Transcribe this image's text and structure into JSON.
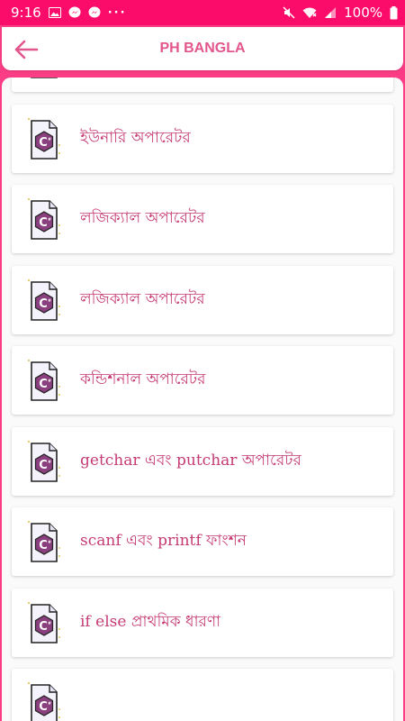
{
  "status_bar": {
    "time": "9:16",
    "dots": "···",
    "battery": "100%"
  },
  "app_bar": {
    "title": "PH BANGLA",
    "back_icon": "arrow-left-icon"
  },
  "colors": {
    "status_bar": "#fb0c6a",
    "frame": "#fb3d86",
    "title": "#e2568d",
    "item_text": "#c53b74",
    "icon_purple": "#8a3f7e"
  },
  "items": [
    {
      "label": "গাণিতিক অপারেটর",
      "icon": "c-file-icon"
    },
    {
      "label": "ইউনারি অপারেটর",
      "icon": "c-file-icon"
    },
    {
      "label": "লজিক্যাল অপারেটর",
      "icon": "c-file-icon"
    },
    {
      "label": "লজিক্যাল অপারেটর",
      "icon": "c-file-icon"
    },
    {
      "label": "কন্ডিশনাল অপারেটর",
      "icon": "c-file-icon"
    },
    {
      "label": "getchar এবং putchar অপারেটর",
      "icon": "c-file-icon"
    },
    {
      "label": "scanf এবং printf ফাংশন",
      "icon": "c-file-icon"
    },
    {
      "label": "if else প্রাথমিক ধারণা",
      "icon": "c-file-icon"
    },
    {
      "label": "",
      "icon": "c-file-icon"
    }
  ]
}
